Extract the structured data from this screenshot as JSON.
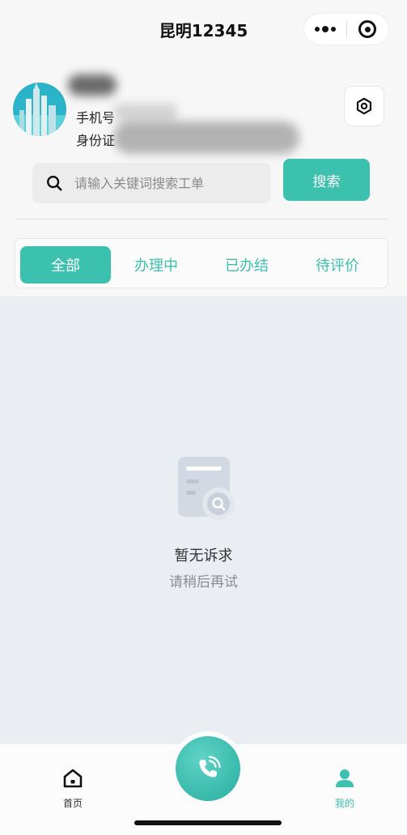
{
  "titlebar": {
    "title": "昆明12345"
  },
  "profile": {
    "phone_label": "手机号",
    "id_label": "身份证"
  },
  "search": {
    "placeholder": "请输入关键词搜索工单",
    "button_label": "搜索"
  },
  "tabs": [
    {
      "label": "全部",
      "active": true
    },
    {
      "label": "办理中",
      "active": false
    },
    {
      "label": "已办结",
      "active": false
    },
    {
      "label": "待评价",
      "active": false
    }
  ],
  "empty_state": {
    "title": "暂无诉求",
    "subtitle": "请稍后再试",
    "icon": "empty-document-search-icon"
  },
  "bottom_nav": {
    "home_label": "首页",
    "call_icon": "phone-call-icon",
    "mine_label": "我的"
  },
  "colors": {
    "accent": "#3cc1ae",
    "content_bg": "#eaedf1",
    "page_bg": "#f7f7f7"
  }
}
